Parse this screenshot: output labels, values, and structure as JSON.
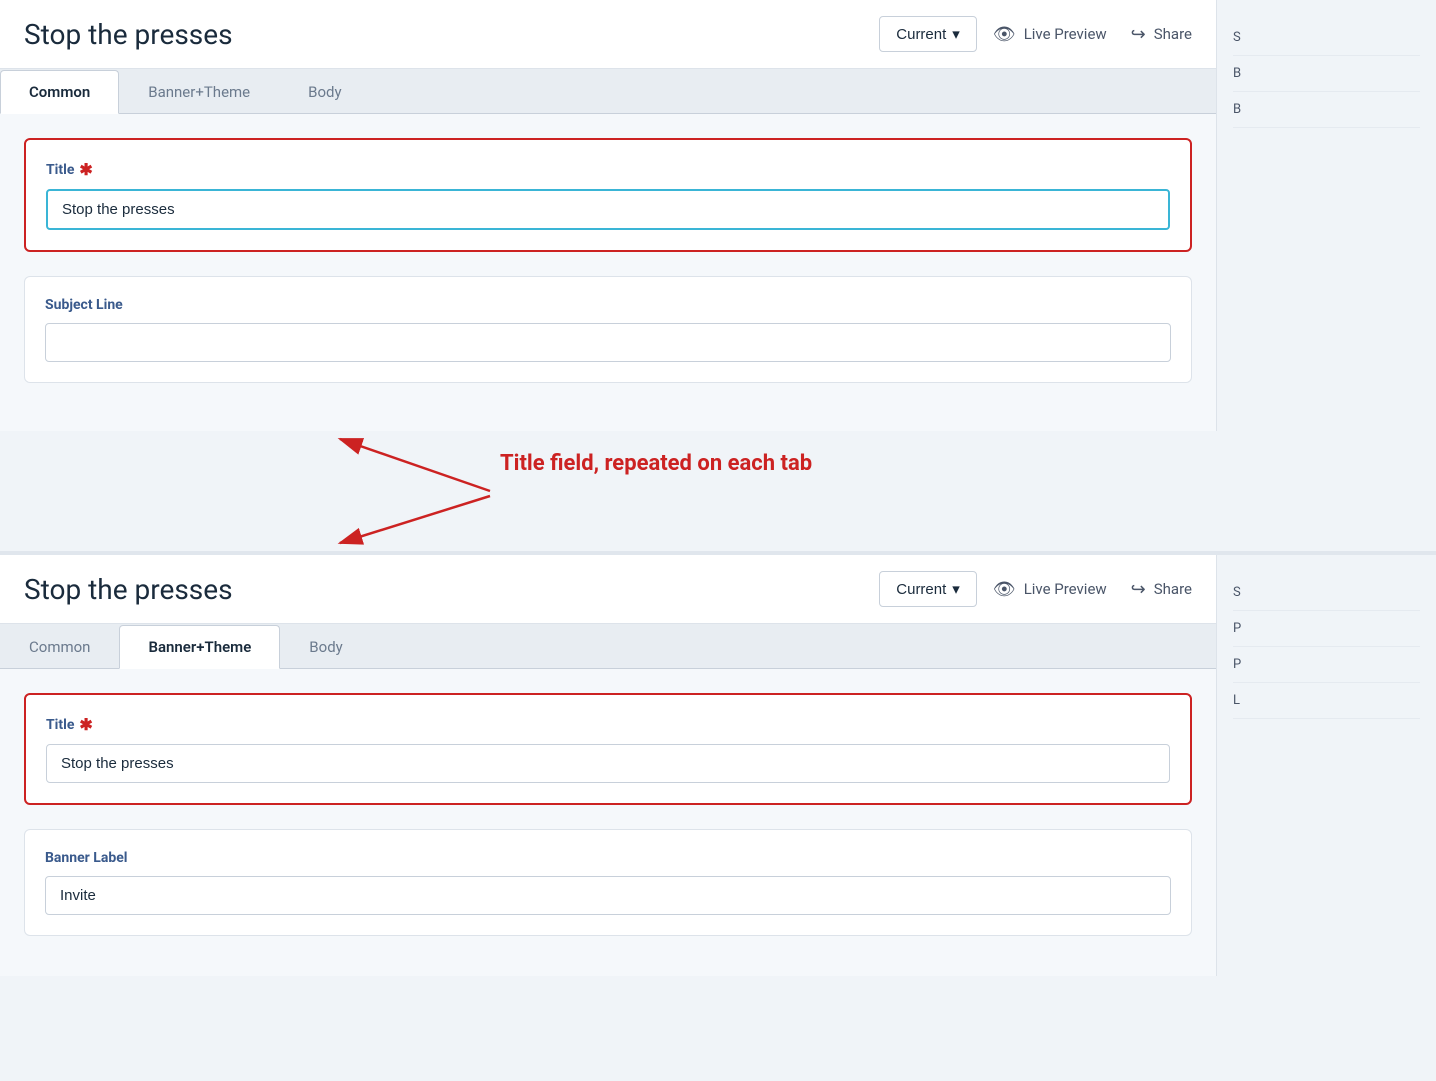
{
  "app": {
    "title": "Stop the presses"
  },
  "section1": {
    "header": {
      "title": "Stop the presses",
      "version_label": "Current",
      "version_chevron": "▾",
      "live_preview_label": "Live Preview",
      "share_label": "Share"
    },
    "tabs": [
      {
        "id": "common",
        "label": "Common",
        "active": true
      },
      {
        "id": "banner-theme",
        "label": "Banner+Theme",
        "active": false
      },
      {
        "id": "body",
        "label": "Body",
        "active": false
      }
    ],
    "fields": {
      "title_label": "Title",
      "title_required": "✱",
      "title_value": "Stop the presses",
      "subject_label": "Subject Line",
      "subject_value": ""
    }
  },
  "annotation": {
    "text": "Title field, repeated on each tab"
  },
  "section2": {
    "header": {
      "title": "Stop the presses",
      "version_label": "Current",
      "version_chevron": "▾",
      "live_preview_label": "Live Preview",
      "share_label": "Share"
    },
    "tabs": [
      {
        "id": "common",
        "label": "Common",
        "active": false
      },
      {
        "id": "banner-theme",
        "label": "Banner+Theme",
        "active": true
      },
      {
        "id": "body",
        "label": "Body",
        "active": false
      }
    ],
    "fields": {
      "title_label": "Title",
      "title_required": "✱",
      "title_value": "Stop the presses",
      "banner_label": "Banner Label",
      "banner_value": "Invite"
    }
  },
  "icons": {
    "eye": "👁",
    "share": "↪",
    "chevron": "›"
  }
}
